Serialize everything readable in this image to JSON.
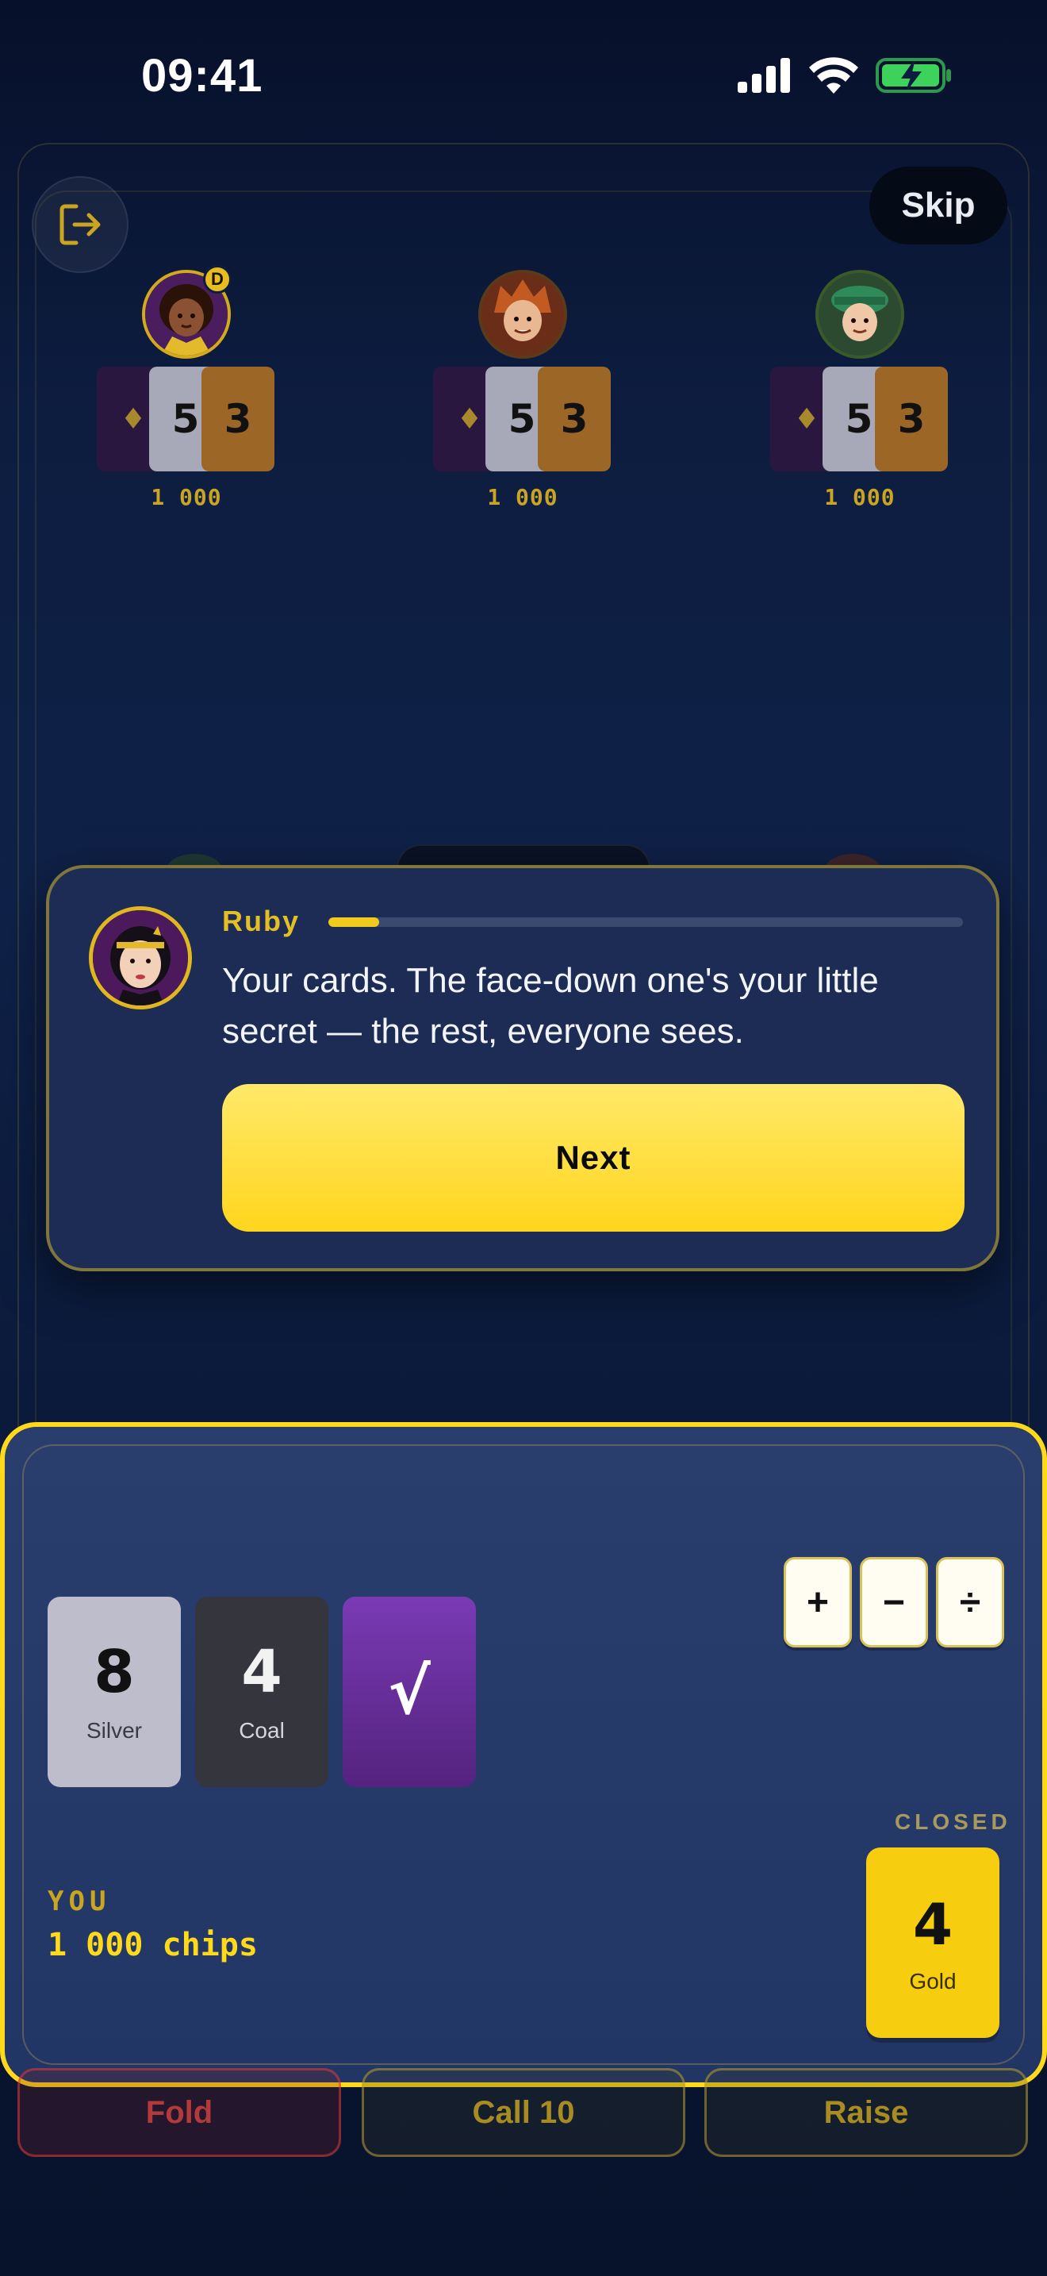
{
  "status_bar": {
    "time": "09:41",
    "icons": [
      "signal-icon",
      "wifi-icon",
      "battery-charging-icon"
    ]
  },
  "top_controls": {
    "exit_icon": "exit-icon",
    "skip_label": "Skip"
  },
  "opponents": [
    {
      "name": "opponent-left",
      "chips": "1 000",
      "dealer": true,
      "dealer_label": "D",
      "cards": [
        "♦",
        "5",
        "3"
      ]
    },
    {
      "name": "opponent-center",
      "chips": "1 000",
      "dealer": false,
      "cards": [
        "♦",
        "5",
        "3"
      ]
    },
    {
      "name": "opponent-right",
      "chips": "1 000",
      "dealer": false,
      "cards": [
        "♦",
        "5",
        "3"
      ]
    }
  ],
  "tutorial": {
    "speaker": "Ruby",
    "progress": 0.08,
    "text": "Your cards. The face-down one's your little secret — the rest, everyone sees.",
    "next_label": "Next"
  },
  "player": {
    "operators": [
      "+",
      "−",
      "÷"
    ],
    "cards": [
      {
        "value": "8",
        "label": "Silver"
      },
      {
        "value": "4",
        "label": "Coal"
      },
      {
        "value": "√",
        "label": ""
      }
    ],
    "you_label": "YOU",
    "chips": "1 000 chips",
    "closed_label": "CLOSED",
    "closed_card": {
      "value": "4",
      "label": "Gold"
    }
  },
  "actions": {
    "fold": "Fold",
    "call": "Call 10",
    "raise": "Raise"
  },
  "colors": {
    "accent": "#ffd91a",
    "gold_text": "#c9a521",
    "background": "#0d1d40",
    "dialog": "#1c2c55"
  }
}
